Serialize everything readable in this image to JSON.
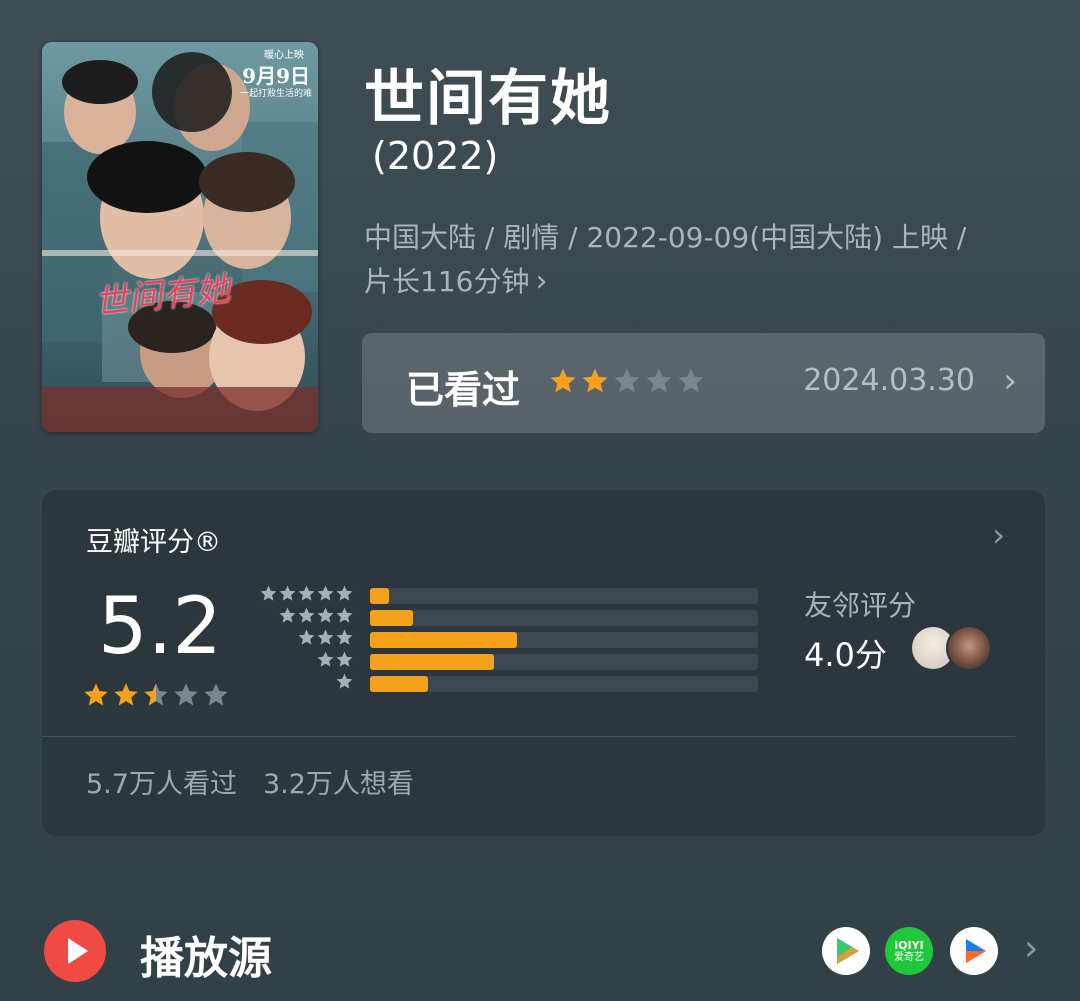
{
  "movie": {
    "title": "世间有她",
    "year": "(2022)",
    "meta_line1": "中国大陆 / 剧情 / 2022-09-09(中国大陆) 上映 /",
    "meta_line2": "片长116分钟",
    "poster": {
      "release_badge_top": "暖心上映",
      "release_badge_date": "9月9日",
      "release_badge_sub": "一起打败生活的难",
      "title_art": "世间有她"
    }
  },
  "watched": {
    "label": "已看过",
    "user_rating": 2,
    "max_rating": 5,
    "date": "2024.03.30"
  },
  "douban": {
    "header": "豆瓣评分®",
    "score": "5.2",
    "score_stars": 2.5,
    "distribution": [
      {
        "stars": 5,
        "fraction": 0.05
      },
      {
        "stars": 4,
        "fraction": 0.11
      },
      {
        "stars": 3,
        "fraction": 0.38
      },
      {
        "stars": 2,
        "fraction": 0.32
      },
      {
        "stars": 1,
        "fraction": 0.15
      }
    ],
    "friends_label": "友邻评分",
    "friends_value": "4.0分",
    "watched_count": "5.7万人看过",
    "want_count": "3.2万人想看"
  },
  "sources": {
    "label": "播放源",
    "platforms": [
      {
        "name": "tencent-video-icon"
      },
      {
        "name": "iqiyi-icon",
        "text_top": "iQIYI",
        "text_bottom": "爱奇艺"
      },
      {
        "name": "youku-icon"
      }
    ]
  },
  "colors": {
    "accent_star": "#f6a11c",
    "inactive_star": "#7b868c",
    "source_icon": "#ef4b43",
    "iqiyi_green": "#1fc83b"
  }
}
